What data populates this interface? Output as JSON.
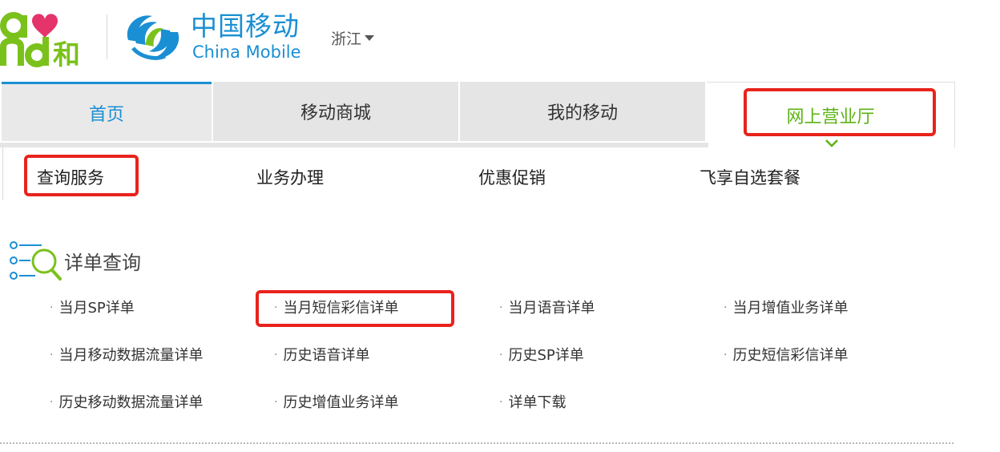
{
  "header": {
    "brand_mark": "and和",
    "logo_cn": "中国移动",
    "logo_en": "China Mobile",
    "region": "浙江"
  },
  "nav": {
    "tabs": [
      {
        "label": "首页"
      },
      {
        "label": "移动商城"
      },
      {
        "label": "我的移动"
      },
      {
        "label": "网上营业厅"
      }
    ],
    "active": "网上营业厅"
  },
  "subnav": {
    "items": [
      {
        "label": "查询服务"
      },
      {
        "label": "业务办理"
      },
      {
        "label": "优惠促销"
      },
      {
        "label": "飞享自选套餐"
      }
    ]
  },
  "section": {
    "title": "详单查询",
    "links": [
      {
        "label": "当月SP详单"
      },
      {
        "label": "当月短信彩信详单"
      },
      {
        "label": "当月语音详单"
      },
      {
        "label": "当月增值业务详单"
      },
      {
        "label": "当月移动数据流量详单"
      },
      {
        "label": "历史语音详单"
      },
      {
        "label": "历史SP详单"
      },
      {
        "label": "历史短信彩信详单"
      },
      {
        "label": "历史移动数据流量详单"
      },
      {
        "label": "历史增值业务详单"
      },
      {
        "label": "详单下载"
      }
    ]
  },
  "colors": {
    "brand_blue": "#1a8fd3",
    "active_green": "#5bb314",
    "highlight_red": "#e8231c",
    "and_pink": "#e5336b",
    "and_green": "#7bc11c"
  },
  "icons": {
    "region_caret": "caret-down-icon",
    "active_chevron": "chevron-down-icon",
    "section_icon": "list-search-icon"
  }
}
